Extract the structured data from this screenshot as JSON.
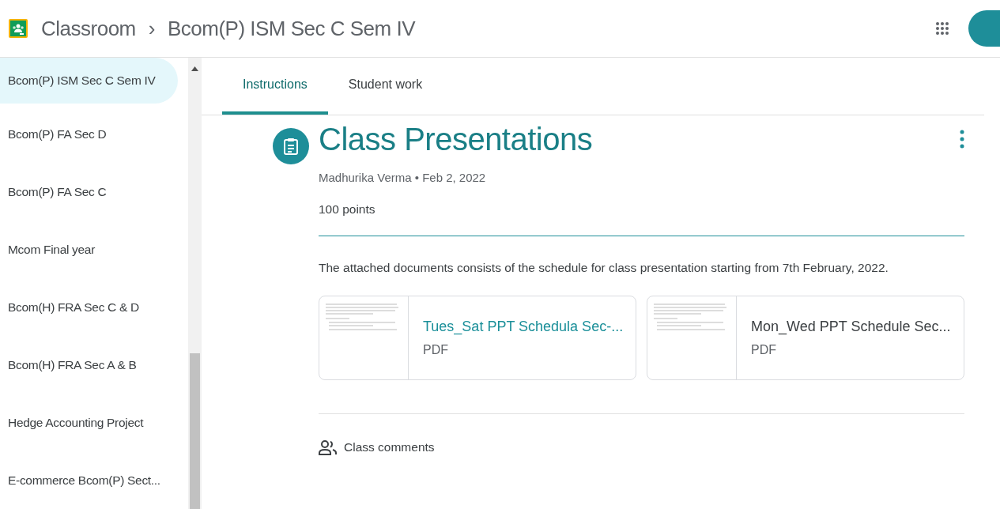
{
  "header": {
    "app_name": "Classroom",
    "separator": "›",
    "course": "Bcom(P) ISM Sec C Sem IV"
  },
  "sidebar": {
    "items": [
      {
        "label": "Bcom(P) ISM Sec C Sem IV",
        "selected": true
      },
      {
        "label": "Bcom(P) FA Sec D",
        "selected": false
      },
      {
        "label": "Bcom(P) FA Sec C",
        "selected": false
      },
      {
        "label": "Mcom Final year",
        "selected": false
      },
      {
        "label": "Bcom(H) FRA Sec C & D",
        "selected": false
      },
      {
        "label": "Bcom(H) FRA Sec A & B",
        "selected": false
      },
      {
        "label": "Hedge Accounting Project",
        "selected": false
      },
      {
        "label": "E-commerce Bcom(P) Sect...",
        "selected": false
      }
    ]
  },
  "tabs": [
    {
      "label": "Instructions",
      "selected": true
    },
    {
      "label": "Student work",
      "selected": false
    }
  ],
  "assignment": {
    "title": "Class Presentations",
    "meta": "Madhurika Verma • Feb 2, 2022",
    "points": "100 points",
    "description": "The attached documents consists of the schedule for class presentation starting from 7th February, 2022.",
    "attachments": [
      {
        "title": "Tues_Sat PPT Schedula Sec-...",
        "type": "PDF",
        "hovered": true
      },
      {
        "title": "Mon_Wed PPT Schedule Sec...",
        "type": "PDF",
        "hovered": false
      }
    ],
    "comments_label": "Class comments"
  }
}
